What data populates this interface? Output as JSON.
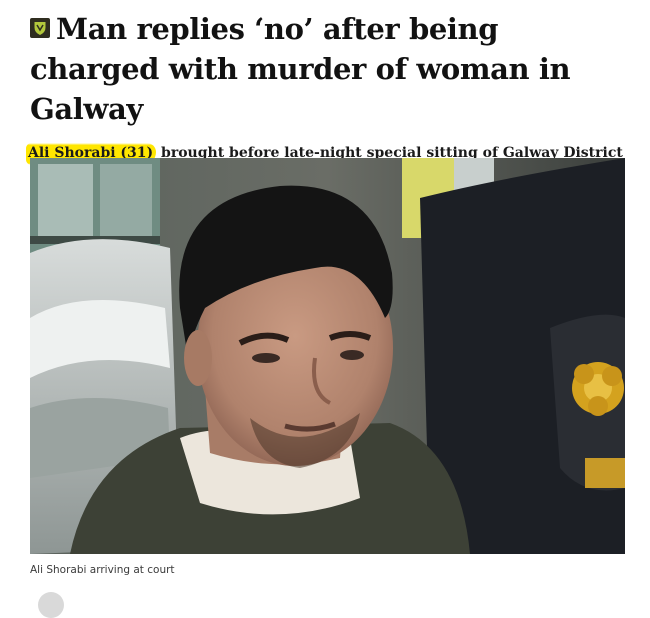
{
  "article": {
    "headline": "Man replies ‘no’ after being charged with murder of woman in Galway",
    "standfirst_highlight": "Ali Shorabi (31)",
    "standfirst_rest": " brought before late-night special sitting of Galway District Court after his arrest",
    "caption": "Ali Shorabi arriving at court",
    "badge_icon": "shield-badge-icon",
    "highlight_color": "#ffe600"
  }
}
